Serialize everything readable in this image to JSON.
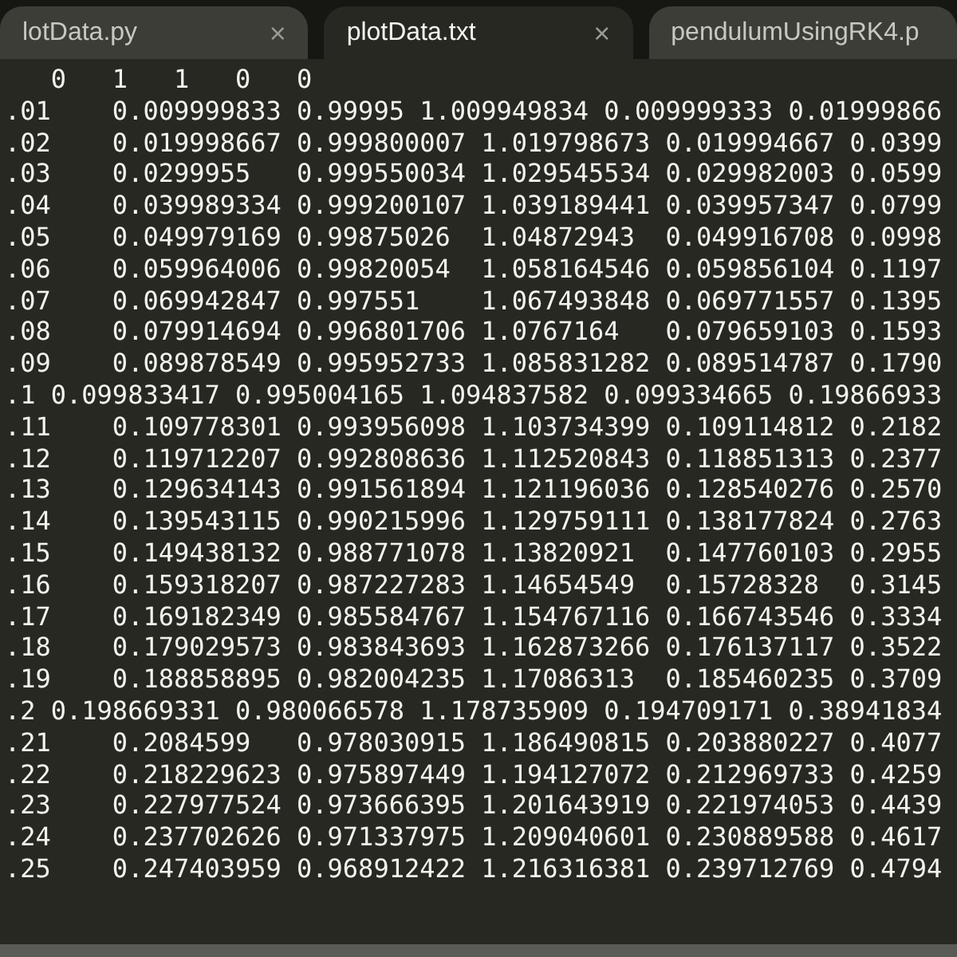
{
  "tabs": [
    {
      "label": "lotData.py",
      "close": "×",
      "selected": false
    },
    {
      "label": "plotData.txt",
      "close": "×",
      "selected": true
    },
    {
      "label": "pendulumUsingRK4.p",
      "selected": false
    }
  ],
  "editor": {
    "lines": [
      "   0   1   1   0   0",
      ".01    0.009999833 0.99995 1.009949834 0.009999333 0.01999866",
      ".02    0.019998667 0.999800007 1.019798673 0.019994667 0.0399",
      ".03    0.0299955   0.999550034 1.029545534 0.029982003 0.0599",
      ".04    0.039989334 0.999200107 1.039189441 0.039957347 0.0799",
      ".05    0.049979169 0.99875026  1.04872943  0.049916708 0.0998",
      ".06    0.059964006 0.99820054  1.058164546 0.059856104 0.1197",
      ".07    0.069942847 0.997551    1.067493848 0.069771557 0.1395",
      ".08    0.079914694 0.996801706 1.0767164   0.079659103 0.1593",
      ".09    0.089878549 0.995952733 1.085831282 0.089514787 0.1790",
      ".1 0.099833417 0.995004165 1.094837582 0.099334665 0.19866933",
      ".11    0.109778301 0.993956098 1.103734399 0.109114812 0.2182",
      ".12    0.119712207 0.992808636 1.112520843 0.118851313 0.2377",
      ".13    0.129634143 0.991561894 1.121196036 0.128540276 0.2570",
      ".14    0.139543115 0.990215996 1.129759111 0.138177824 0.2763",
      ".15    0.149438132 0.988771078 1.13820921  0.147760103 0.2955",
      ".16    0.159318207 0.987227283 1.14654549  0.15728328  0.3145",
      ".17    0.169182349 0.985584767 1.154767116 0.166743546 0.3334",
      ".18    0.179029573 0.983843693 1.162873266 0.176137117 0.3522",
      ".19    0.188858895 0.982004235 1.17086313  0.185460235 0.3709",
      ".2 0.198669331 0.980066578 1.178735909 0.194709171 0.38941834",
      ".21    0.2084599   0.978030915 1.186490815 0.203880227 0.4077",
      ".22    0.218229623 0.975897449 1.194127072 0.212969733 0.4259",
      ".23    0.227977524 0.973666395 1.201643919 0.221974053 0.4439",
      ".24    0.237702626 0.971337975 1.209040601 0.230889588 0.4617",
      ".25    0.247403959 0.968912422 1.216316381 0.239712769 0.4794"
    ]
  }
}
